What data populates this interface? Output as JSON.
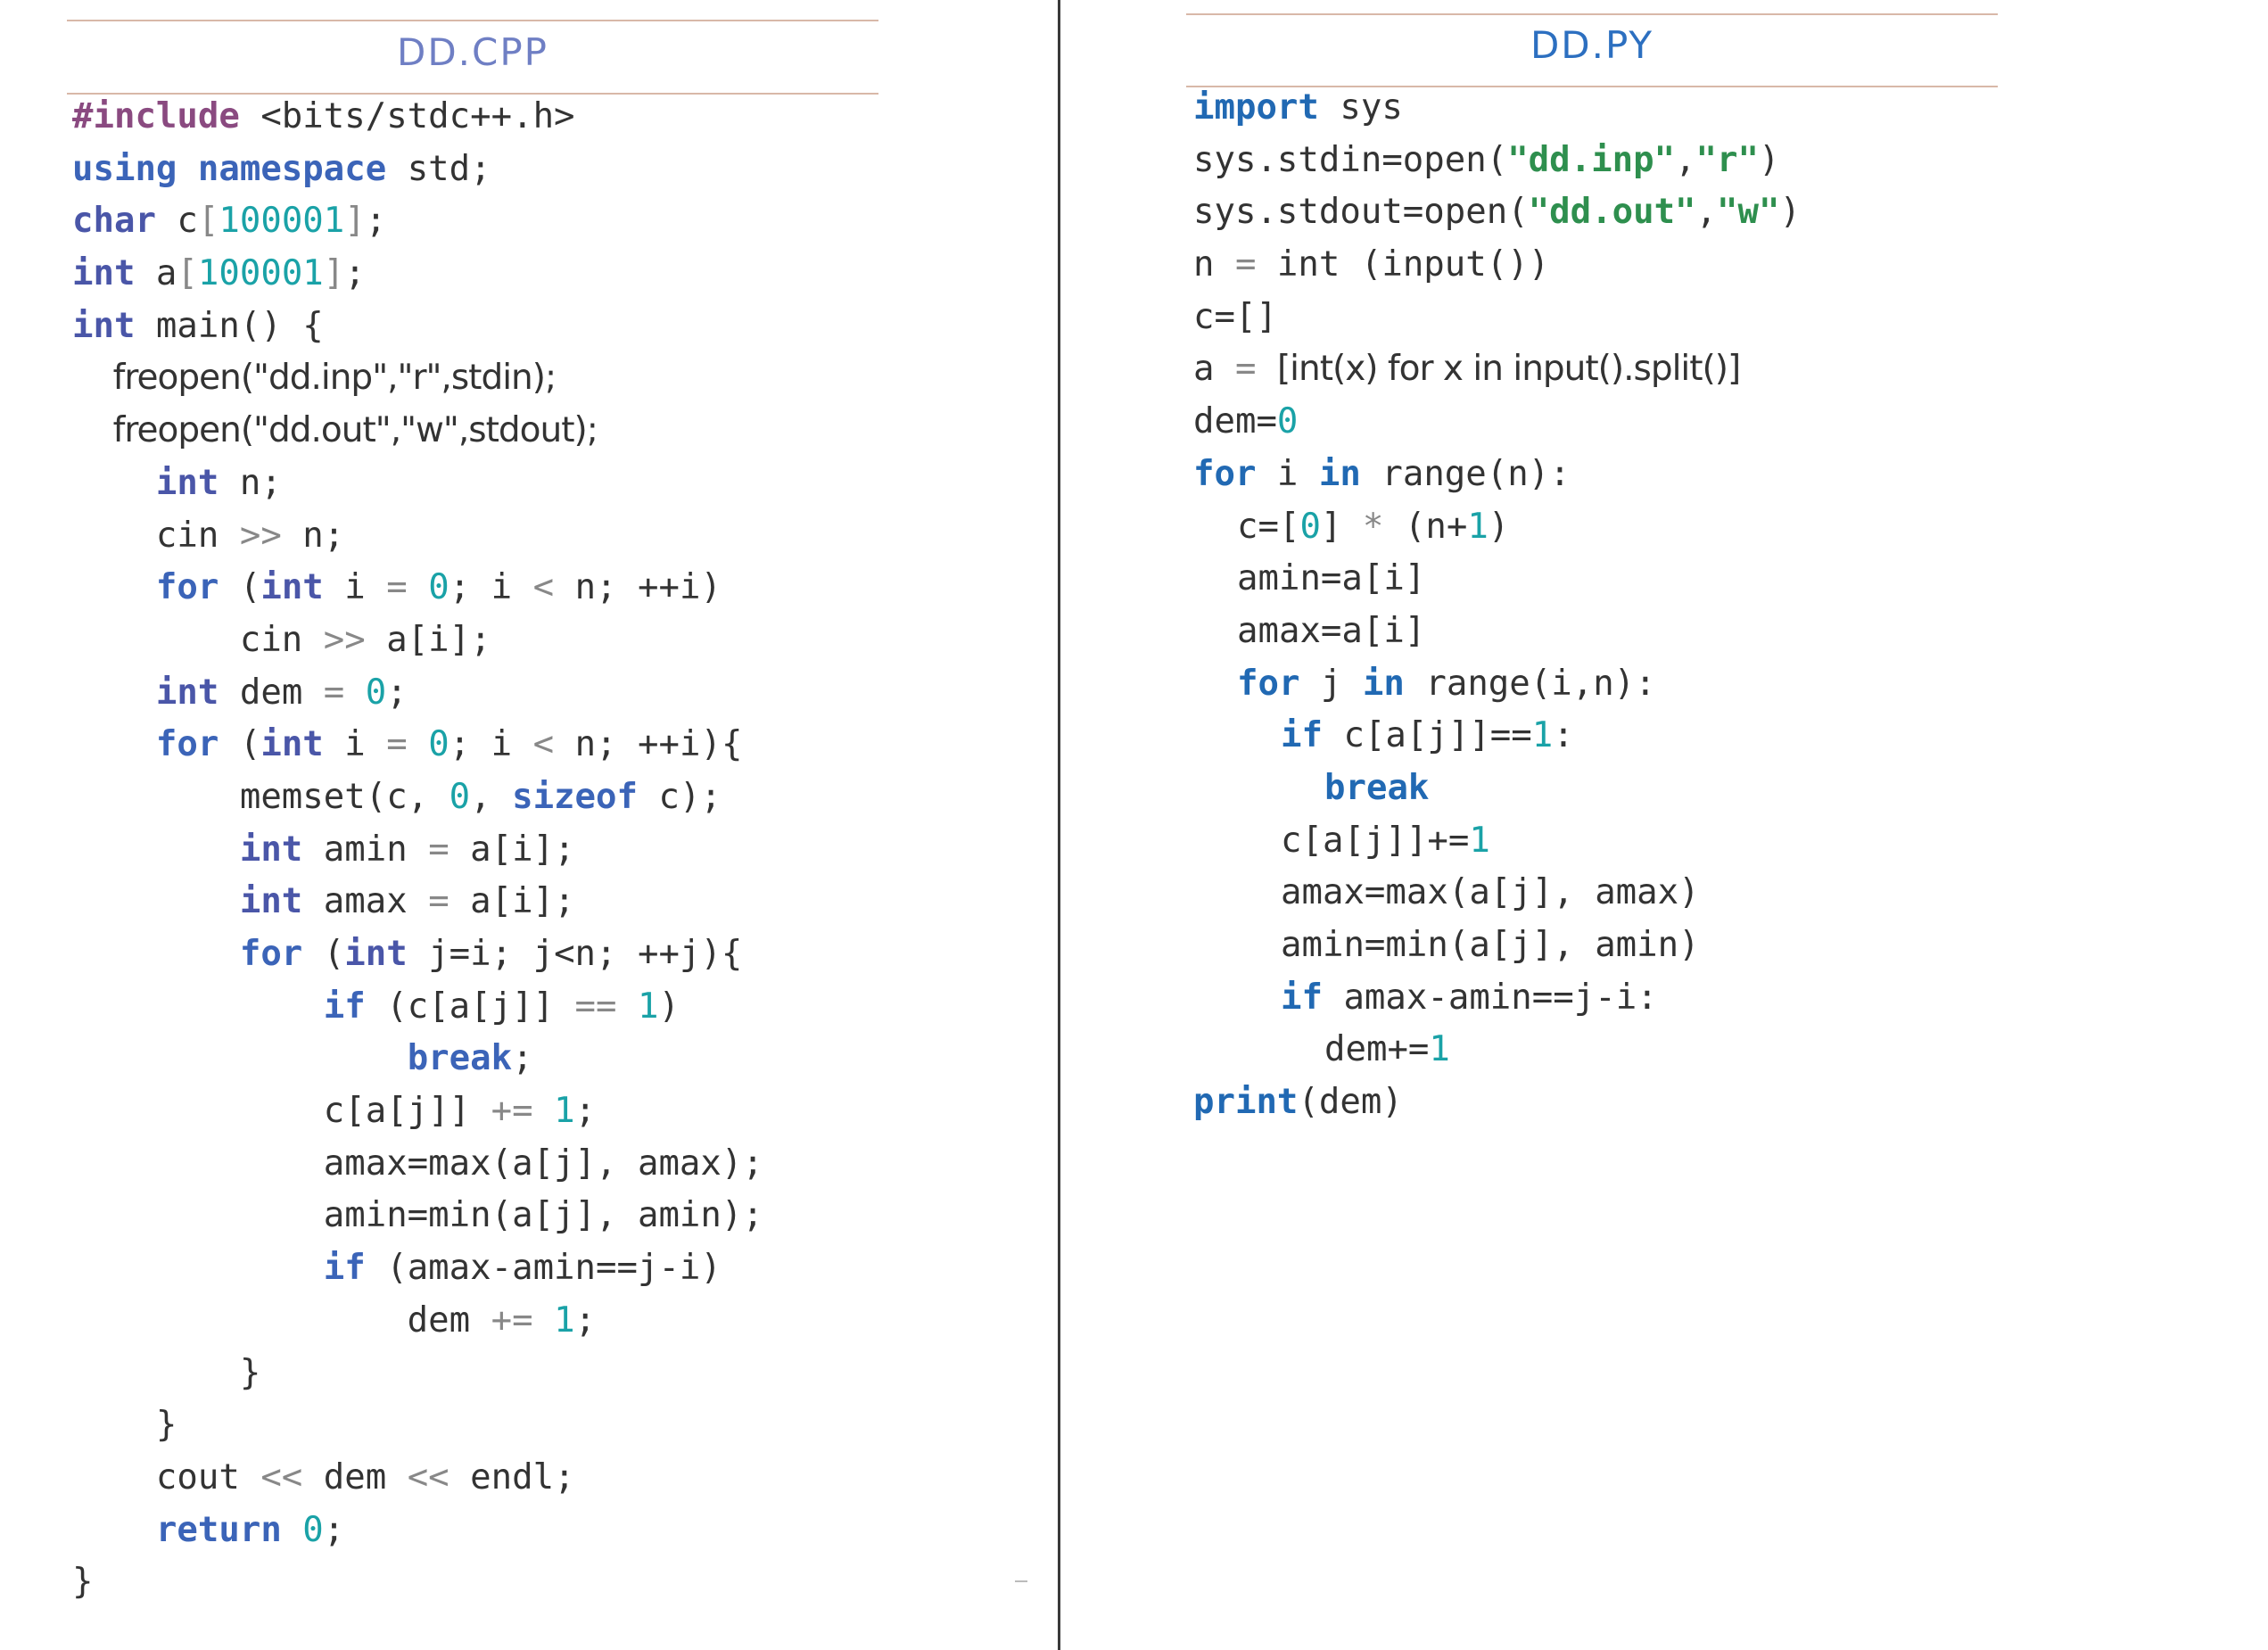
{
  "cpp": {
    "title": "DD.CPP",
    "lines": [
      [
        [
          "pp",
          "#include"
        ],
        [
          "plain",
          " <bits/stdc++.h>"
        ]
      ],
      [
        [
          "kw",
          "using"
        ],
        [
          "plain",
          " "
        ],
        [
          "kw",
          "namespace"
        ],
        [
          "plain",
          " std;"
        ]
      ],
      [
        [
          "ty",
          "char"
        ],
        [
          "plain",
          " c"
        ],
        [
          "br",
          "["
        ],
        [
          "num",
          "100001"
        ],
        [
          "br",
          "]"
        ],
        [
          "plain",
          ";"
        ]
      ],
      [
        [
          "ty",
          "int"
        ],
        [
          "plain",
          " a"
        ],
        [
          "br",
          "["
        ],
        [
          "num",
          "100001"
        ],
        [
          "br",
          "]"
        ],
        [
          "plain",
          ";"
        ]
      ],
      [
        [
          "ty",
          "int"
        ],
        [
          "plain",
          " main() {"
        ]
      ],
      [
        [
          "sans",
          "    freopen(\"dd.inp\",\"r\",stdin);"
        ]
      ],
      [
        [
          "sans",
          "    freopen(\"dd.out\",\"w\",stdout);"
        ]
      ],
      [
        [
          "plain",
          "    "
        ],
        [
          "ty",
          "int"
        ],
        [
          "plain",
          " n;"
        ]
      ],
      [
        [
          "plain",
          "    cin "
        ],
        [
          "op",
          ">>"
        ],
        [
          "plain",
          " n;"
        ]
      ],
      [
        [
          "plain",
          "    "
        ],
        [
          "kw",
          "for"
        ],
        [
          "plain",
          " ("
        ],
        [
          "ty",
          "int"
        ],
        [
          "plain",
          " i "
        ],
        [
          "op",
          "="
        ],
        [
          "plain",
          " "
        ],
        [
          "num",
          "0"
        ],
        [
          "plain",
          "; i "
        ],
        [
          "op",
          "<"
        ],
        [
          "plain",
          " n; ++i)"
        ]
      ],
      [
        [
          "plain",
          "        cin "
        ],
        [
          "op",
          ">>"
        ],
        [
          "plain",
          " a[i];"
        ]
      ],
      [
        [
          "plain",
          "    "
        ],
        [
          "ty",
          "int"
        ],
        [
          "plain",
          " dem "
        ],
        [
          "op",
          "="
        ],
        [
          "plain",
          " "
        ],
        [
          "num",
          "0"
        ],
        [
          "plain",
          ";"
        ]
      ],
      [
        [
          "plain",
          "    "
        ],
        [
          "kw",
          "for"
        ],
        [
          "plain",
          " ("
        ],
        [
          "ty",
          "int"
        ],
        [
          "plain",
          " i "
        ],
        [
          "op",
          "="
        ],
        [
          "plain",
          " "
        ],
        [
          "num",
          "0"
        ],
        [
          "plain",
          "; i "
        ],
        [
          "op",
          "<"
        ],
        [
          "plain",
          " n; ++i){"
        ]
      ],
      [
        [
          "plain",
          "        memset(c, "
        ],
        [
          "num",
          "0"
        ],
        [
          "plain",
          ", "
        ],
        [
          "kw",
          "sizeof"
        ],
        [
          "plain",
          " c);"
        ]
      ],
      [
        [
          "plain",
          "        "
        ],
        [
          "ty",
          "int"
        ],
        [
          "plain",
          " amin "
        ],
        [
          "op",
          "="
        ],
        [
          "plain",
          " a[i];"
        ]
      ],
      [
        [
          "plain",
          "        "
        ],
        [
          "ty",
          "int"
        ],
        [
          "plain",
          " amax "
        ],
        [
          "op",
          "="
        ],
        [
          "plain",
          " a[i];"
        ]
      ],
      [
        [
          "plain",
          "        "
        ],
        [
          "kw",
          "for"
        ],
        [
          "plain",
          " ("
        ],
        [
          "ty",
          "int"
        ],
        [
          "plain",
          " j=i; j<n; ++j){"
        ]
      ],
      [
        [
          "plain",
          "            "
        ],
        [
          "kw",
          "if"
        ],
        [
          "plain",
          " (c[a[j]] "
        ],
        [
          "op",
          "=="
        ],
        [
          "plain",
          " "
        ],
        [
          "num",
          "1"
        ],
        [
          "plain",
          ")"
        ]
      ],
      [
        [
          "plain",
          "                "
        ],
        [
          "kw",
          "break"
        ],
        [
          "plain",
          ";"
        ]
      ],
      [
        [
          "plain",
          "            c[a[j]] "
        ],
        [
          "op",
          "+="
        ],
        [
          "plain",
          " "
        ],
        [
          "num",
          "1"
        ],
        [
          "plain",
          ";"
        ]
      ],
      [
        [
          "plain",
          "            amax=max(a[j], amax);"
        ]
      ],
      [
        [
          "plain",
          "            amin=min(a[j], amin);"
        ]
      ],
      [
        [
          "plain",
          "            "
        ],
        [
          "kw",
          "if"
        ],
        [
          "plain",
          " (amax-amin==j-i)"
        ]
      ],
      [
        [
          "plain",
          "                dem "
        ],
        [
          "op",
          "+="
        ],
        [
          "plain",
          " "
        ],
        [
          "num",
          "1"
        ],
        [
          "plain",
          ";"
        ]
      ],
      [
        [
          "plain",
          "        }"
        ]
      ],
      [
        [
          "plain",
          "    }"
        ]
      ],
      [
        [
          "plain",
          "    cout "
        ],
        [
          "op",
          "<<"
        ],
        [
          "plain",
          " dem "
        ],
        [
          "op",
          "<<"
        ],
        [
          "plain",
          " endl;"
        ]
      ],
      [
        [
          "plain",
          "    "
        ],
        [
          "kw",
          "return"
        ],
        [
          "plain",
          " "
        ],
        [
          "num",
          "0"
        ],
        [
          "plain",
          ";"
        ]
      ],
      [
        [
          "plain",
          "}"
        ]
      ]
    ]
  },
  "py": {
    "title": "DD.PY",
    "lines": [
      [
        [
          "kw-bl",
          "import"
        ],
        [
          "plain",
          " sys"
        ]
      ],
      [
        [
          "plain",
          "sys.stdin=open("
        ],
        [
          "str-b",
          "\"dd.inp\""
        ],
        [
          "plain",
          ","
        ],
        [
          "str-b",
          "\"r\""
        ],
        [
          "plain",
          ")"
        ]
      ],
      [
        [
          "plain",
          "sys.stdout=open("
        ],
        [
          "str-b",
          "\"dd.out\""
        ],
        [
          "plain",
          ","
        ],
        [
          "str-b",
          "\"w\""
        ],
        [
          "plain",
          ")"
        ]
      ],
      [
        [
          "plain",
          "n "
        ],
        [
          "op",
          "="
        ],
        [
          "plain",
          " int (input())"
        ]
      ],
      [
        [
          "plain",
          "c=[]"
        ]
      ],
      [
        [
          "plain",
          "a "
        ],
        [
          "op",
          "="
        ],
        [
          "plain",
          " "
        ],
        [
          "sans-py",
          "[int(x) for x in input().split()]"
        ]
      ],
      [
        [
          "plain",
          "dem="
        ],
        [
          "num",
          "0"
        ]
      ],
      [
        [
          "kw-bl",
          "for"
        ],
        [
          "plain",
          " i "
        ],
        [
          "kw-bl",
          "in"
        ],
        [
          "plain",
          " range(n):"
        ]
      ],
      [
        [
          "plain",
          " c=["
        ],
        [
          "num",
          "0"
        ],
        [
          "plain",
          "] "
        ],
        [
          "op",
          "*"
        ],
        [
          "plain",
          " (n+"
        ],
        [
          "num",
          "1"
        ],
        [
          "plain",
          ")"
        ]
      ],
      [
        [
          "plain",
          " amin=a[i]"
        ]
      ],
      [
        [
          "plain",
          " amax=a[i]"
        ]
      ],
      [
        [
          "plain",
          " "
        ],
        [
          "kw-bl",
          "for"
        ],
        [
          "plain",
          " j "
        ],
        [
          "kw-bl",
          "in"
        ],
        [
          "plain",
          " range(i,n):"
        ]
      ],
      [
        [
          "plain",
          "  "
        ],
        [
          "kw-bl",
          "if"
        ],
        [
          "plain",
          " c[a[j]]=="
        ],
        [
          "num",
          "1"
        ],
        [
          "plain",
          ":"
        ]
      ],
      [
        [
          "plain",
          "   "
        ],
        [
          "kw-bl",
          "break"
        ]
      ],
      [
        [
          "plain",
          "  c[a[j]]+="
        ],
        [
          "num",
          "1"
        ]
      ],
      [
        [
          "plain",
          "  amax=max(a[j], amax)"
        ]
      ],
      [
        [
          "plain",
          "  amin=min(a[j], amin)"
        ]
      ],
      [
        [
          "plain",
          "  "
        ],
        [
          "kw-bl",
          "if"
        ],
        [
          "plain",
          " amax-amin==j-i:"
        ]
      ],
      [
        [
          "plain",
          "   dem+="
        ],
        [
          "num",
          "1"
        ]
      ],
      [
        [
          "kw-bl",
          "print"
        ],
        [
          "plain",
          "(dem)"
        ]
      ]
    ]
  }
}
